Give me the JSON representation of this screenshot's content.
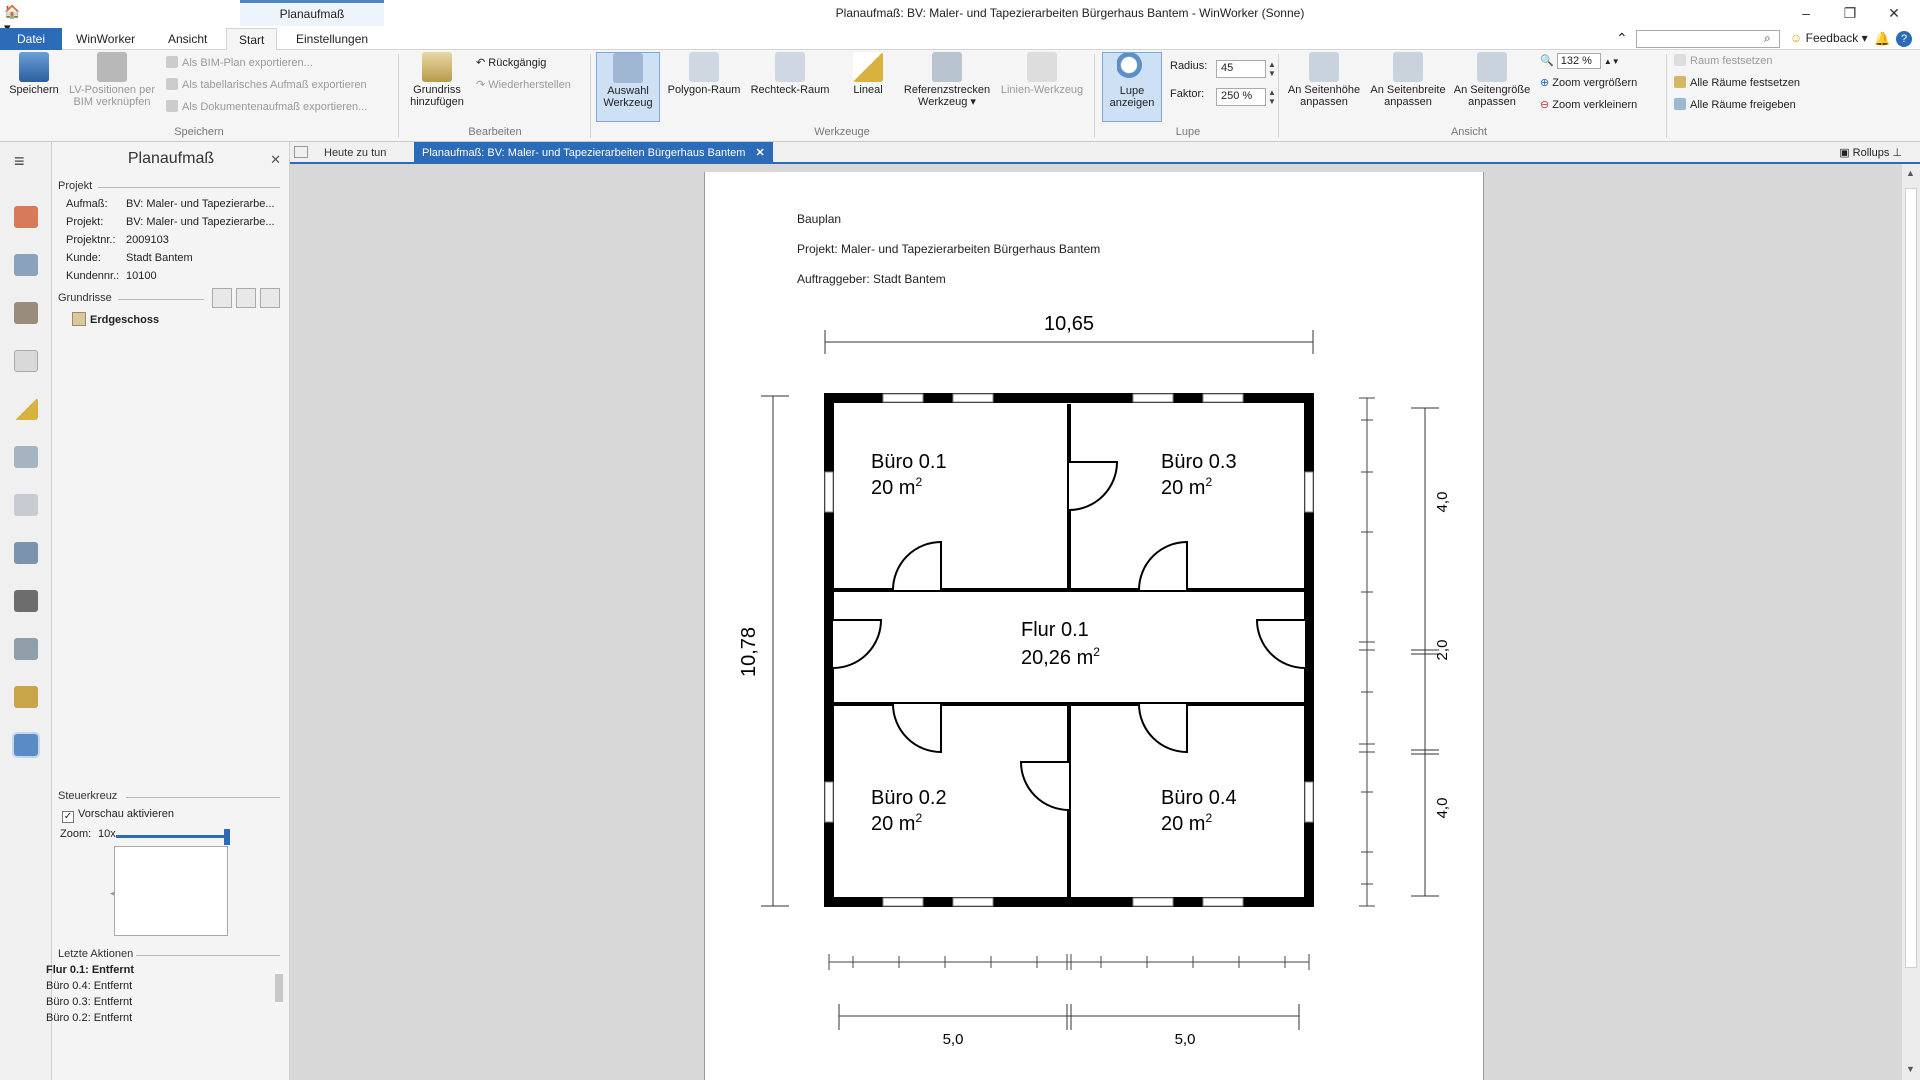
{
  "window": {
    "app_icon": "winworker-icon",
    "context_tab": "Planaufmaß",
    "title": "Planaufmaß: BV: Maler- und Tapezierarbeiten Bürgerhaus Bantem - WinWorker (Sonne)",
    "controls": [
      "–",
      "❐",
      "✕"
    ]
  },
  "menu_tabs": [
    {
      "label": "Datei"
    },
    {
      "label": "WinWorker"
    },
    {
      "label": "Ansicht"
    },
    {
      "label": "Start"
    },
    {
      "label": "Einstellungen"
    }
  ],
  "topright": {
    "feedback": "Feedback ▾",
    "help": "?"
  },
  "ribbon": {
    "speichern": {
      "save": "Speichern",
      "lv_link": "LV-Positionen per BIM verknüpfen",
      "export_bim": "Als BIM-Plan exportieren...",
      "export_table": "Als tabellarisches Aufmaß exportieren",
      "export_doc": "Als Dokumentenaufmaß exportieren...",
      "group": "Speichern"
    },
    "bearbeiten": {
      "add_plan": "Grundriss hinzufügen",
      "undo": "Rückgängig",
      "redo": "Wiederherstellen",
      "group": "Bearbeiten"
    },
    "werkzeuge": {
      "select": "Auswahl Werkzeug",
      "polygon": "Polygon-Raum",
      "rect": "Rechteck-Raum",
      "ruler": "Lineal",
      "ref": "Referenzstrecken Werkzeug ▾",
      "line": "Linien-Werkzeug",
      "group": "Werkzeuge"
    },
    "lupe": {
      "show": "Lupe anzeigen",
      "radius_label": "Radius:",
      "radius_value": "45",
      "factor_label": "Faktor:",
      "factor_value": "250 %",
      "group": "Lupe"
    },
    "ansicht": {
      "fit_height": "An Seitenhöhe anpassen",
      "fit_width": "An Seitenbreite anpassen",
      "fit_page": "An Seitengröße anpassen",
      "zoom_value": "132 %",
      "zoom_in": "Zoom vergrößern",
      "zoom_out": "Zoom verkleinern",
      "group": "Ansicht"
    },
    "raeume": {
      "fix_room": "Raum festsetzen",
      "fix_all": "Alle Räume festsetzen",
      "release_all": "Alle Räume freigeben"
    }
  },
  "side_panel": {
    "title": "Planaufmaß",
    "project_header": "Projekt",
    "project": [
      {
        "k": "Aufmaß:",
        "v": "BV: Maler- und Tapezierarbe..."
      },
      {
        "k": "Projekt:",
        "v": "BV: Maler- und Tapezierarbe..."
      },
      {
        "k": "Projektnr.:",
        "v": "2009103"
      },
      {
        "k": "Kunde:",
        "v": "Stadt Bantem"
      },
      {
        "k": "Kundennr.:",
        "v": "10100"
      }
    ],
    "grundrisse_header": "Grundrisse",
    "floor": "Erdgeschoss",
    "steuerkreuz_header": "Steuerkreuz",
    "preview_label": "Vorschau aktivieren",
    "preview_checked": true,
    "zoom_label": "Zoom:",
    "zoom_value": "10x",
    "zoom_fraction": 1.0,
    "actions_header": "Letzte Aktionen",
    "actions": [
      "Flur 0.1: Entfernt",
      "Büro 0.4: Entfernt",
      "Büro 0.3: Entfernt",
      "Büro 0.2: Entfernt"
    ]
  },
  "doc_tabs": [
    {
      "label": "Heute zu tun"
    },
    {
      "label": "Planaufmaß: BV: Maler- und Tapezierarbeiten Bürgerhaus Bantem",
      "close": "✕"
    }
  ],
  "rollups": "Rollups",
  "plan": {
    "heading": "Bauplan",
    "project_line": "Projekt: Maler- und Tapezierarbeiten Bürgerhaus Bantem",
    "client_line": "Auftraggeber: Stadt Bantem",
    "dim_top": "10,65",
    "dim_left": "10,78",
    "dim_right": [
      "4,0",
      "2,0",
      "4,0"
    ],
    "dim_bottom": [
      "5,0",
      "5,0"
    ],
    "rooms": [
      {
        "name": "Büro 0.1",
        "area": "20 m",
        "sup": "2"
      },
      {
        "name": "Büro 0.3",
        "area": "20 m",
        "sup": "2"
      },
      {
        "name": "Flur 0.1",
        "area": "20,26 m",
        "sup": "2"
      },
      {
        "name": "Büro 0.2",
        "area": "20 m",
        "sup": "2"
      },
      {
        "name": "Büro 0.4",
        "area": "20 m",
        "sup": "2"
      }
    ]
  }
}
